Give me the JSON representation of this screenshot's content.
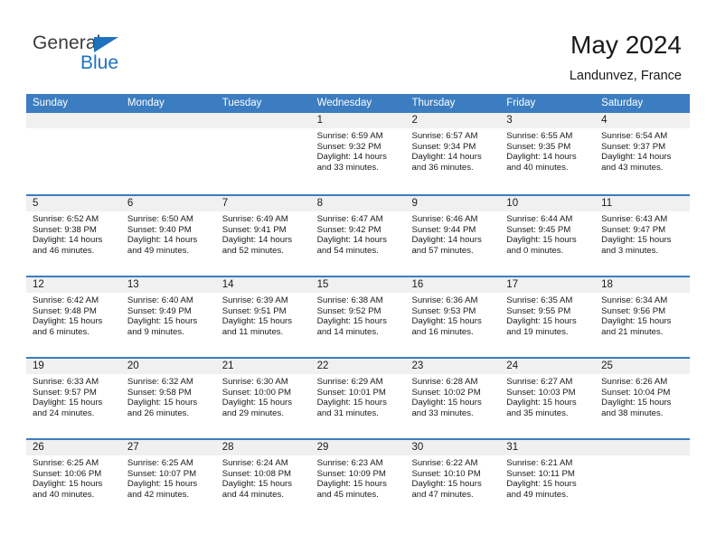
{
  "brand": {
    "name_part1": "General",
    "name_part2": "Blue",
    "triangle_icon": "blue-triangle-icon",
    "accent_color": "#1e72bd"
  },
  "header": {
    "title": "May 2024",
    "subtitle": "Landunvez, France"
  },
  "calendar": {
    "header_bg": "#3b7dc0",
    "daynum_band_bg": "#f0f0f0",
    "weekday_headers": [
      "Sunday",
      "Monday",
      "Tuesday",
      "Wednesday",
      "Thursday",
      "Friday",
      "Saturday"
    ],
    "weeks": [
      [
        {
          "num": "",
          "empty": true
        },
        {
          "num": "",
          "empty": true
        },
        {
          "num": "",
          "empty": true
        },
        {
          "num": "1",
          "sunrise": "Sunrise: 6:59 AM",
          "sunset": "Sunset: 9:32 PM",
          "daylight": "Daylight: 14 hours and 33 minutes."
        },
        {
          "num": "2",
          "sunrise": "Sunrise: 6:57 AM",
          "sunset": "Sunset: 9:34 PM",
          "daylight": "Daylight: 14 hours and 36 minutes."
        },
        {
          "num": "3",
          "sunrise": "Sunrise: 6:55 AM",
          "sunset": "Sunset: 9:35 PM",
          "daylight": "Daylight: 14 hours and 40 minutes."
        },
        {
          "num": "4",
          "sunrise": "Sunrise: 6:54 AM",
          "sunset": "Sunset: 9:37 PM",
          "daylight": "Daylight: 14 hours and 43 minutes."
        }
      ],
      [
        {
          "num": "5",
          "sunrise": "Sunrise: 6:52 AM",
          "sunset": "Sunset: 9:38 PM",
          "daylight": "Daylight: 14 hours and 46 minutes."
        },
        {
          "num": "6",
          "sunrise": "Sunrise: 6:50 AM",
          "sunset": "Sunset: 9:40 PM",
          "daylight": "Daylight: 14 hours and 49 minutes."
        },
        {
          "num": "7",
          "sunrise": "Sunrise: 6:49 AM",
          "sunset": "Sunset: 9:41 PM",
          "daylight": "Daylight: 14 hours and 52 minutes."
        },
        {
          "num": "8",
          "sunrise": "Sunrise: 6:47 AM",
          "sunset": "Sunset: 9:42 PM",
          "daylight": "Daylight: 14 hours and 54 minutes."
        },
        {
          "num": "9",
          "sunrise": "Sunrise: 6:46 AM",
          "sunset": "Sunset: 9:44 PM",
          "daylight": "Daylight: 14 hours and 57 minutes."
        },
        {
          "num": "10",
          "sunrise": "Sunrise: 6:44 AM",
          "sunset": "Sunset: 9:45 PM",
          "daylight": "Daylight: 15 hours and 0 minutes."
        },
        {
          "num": "11",
          "sunrise": "Sunrise: 6:43 AM",
          "sunset": "Sunset: 9:47 PM",
          "daylight": "Daylight: 15 hours and 3 minutes."
        }
      ],
      [
        {
          "num": "12",
          "sunrise": "Sunrise: 6:42 AM",
          "sunset": "Sunset: 9:48 PM",
          "daylight": "Daylight: 15 hours and 6 minutes."
        },
        {
          "num": "13",
          "sunrise": "Sunrise: 6:40 AM",
          "sunset": "Sunset: 9:49 PM",
          "daylight": "Daylight: 15 hours and 9 minutes."
        },
        {
          "num": "14",
          "sunrise": "Sunrise: 6:39 AM",
          "sunset": "Sunset: 9:51 PM",
          "daylight": "Daylight: 15 hours and 11 minutes."
        },
        {
          "num": "15",
          "sunrise": "Sunrise: 6:38 AM",
          "sunset": "Sunset: 9:52 PM",
          "daylight": "Daylight: 15 hours and 14 minutes."
        },
        {
          "num": "16",
          "sunrise": "Sunrise: 6:36 AM",
          "sunset": "Sunset: 9:53 PM",
          "daylight": "Daylight: 15 hours and 16 minutes."
        },
        {
          "num": "17",
          "sunrise": "Sunrise: 6:35 AM",
          "sunset": "Sunset: 9:55 PM",
          "daylight": "Daylight: 15 hours and 19 minutes."
        },
        {
          "num": "18",
          "sunrise": "Sunrise: 6:34 AM",
          "sunset": "Sunset: 9:56 PM",
          "daylight": "Daylight: 15 hours and 21 minutes."
        }
      ],
      [
        {
          "num": "19",
          "sunrise": "Sunrise: 6:33 AM",
          "sunset": "Sunset: 9:57 PM",
          "daylight": "Daylight: 15 hours and 24 minutes."
        },
        {
          "num": "20",
          "sunrise": "Sunrise: 6:32 AM",
          "sunset": "Sunset: 9:58 PM",
          "daylight": "Daylight: 15 hours and 26 minutes."
        },
        {
          "num": "21",
          "sunrise": "Sunrise: 6:30 AM",
          "sunset": "Sunset: 10:00 PM",
          "daylight": "Daylight: 15 hours and 29 minutes."
        },
        {
          "num": "22",
          "sunrise": "Sunrise: 6:29 AM",
          "sunset": "Sunset: 10:01 PM",
          "daylight": "Daylight: 15 hours and 31 minutes."
        },
        {
          "num": "23",
          "sunrise": "Sunrise: 6:28 AM",
          "sunset": "Sunset: 10:02 PM",
          "daylight": "Daylight: 15 hours and 33 minutes."
        },
        {
          "num": "24",
          "sunrise": "Sunrise: 6:27 AM",
          "sunset": "Sunset: 10:03 PM",
          "daylight": "Daylight: 15 hours and 35 minutes."
        },
        {
          "num": "25",
          "sunrise": "Sunrise: 6:26 AM",
          "sunset": "Sunset: 10:04 PM",
          "daylight": "Daylight: 15 hours and 38 minutes."
        }
      ],
      [
        {
          "num": "26",
          "sunrise": "Sunrise: 6:25 AM",
          "sunset": "Sunset: 10:06 PM",
          "daylight": "Daylight: 15 hours and 40 minutes."
        },
        {
          "num": "27",
          "sunrise": "Sunrise: 6:25 AM",
          "sunset": "Sunset: 10:07 PM",
          "daylight": "Daylight: 15 hours and 42 minutes."
        },
        {
          "num": "28",
          "sunrise": "Sunrise: 6:24 AM",
          "sunset": "Sunset: 10:08 PM",
          "daylight": "Daylight: 15 hours and 44 minutes."
        },
        {
          "num": "29",
          "sunrise": "Sunrise: 6:23 AM",
          "sunset": "Sunset: 10:09 PM",
          "daylight": "Daylight: 15 hours and 45 minutes."
        },
        {
          "num": "30",
          "sunrise": "Sunrise: 6:22 AM",
          "sunset": "Sunset: 10:10 PM",
          "daylight": "Daylight: 15 hours and 47 minutes."
        },
        {
          "num": "31",
          "sunrise": "Sunrise: 6:21 AM",
          "sunset": "Sunset: 10:11 PM",
          "daylight": "Daylight: 15 hours and 49 minutes."
        },
        {
          "num": "",
          "empty": true
        }
      ]
    ]
  }
}
